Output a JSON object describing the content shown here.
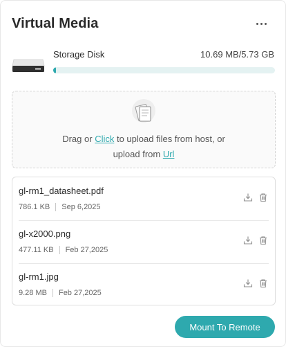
{
  "title": "Virtual Media",
  "storage": {
    "label": "Storage Disk",
    "used": "10.69 MB/5.73 GB",
    "used_fraction": 0.0018,
    "accent": "#2ea9ae",
    "track": "#e4f2f2"
  },
  "upload": {
    "pre": "Drag or ",
    "click": "Click",
    "mid": " to upload files from host, or",
    "line2_pre": "upload from ",
    "url": "Url"
  },
  "files": [
    {
      "name": "gl-rm1_datasheet.pdf",
      "size": "786.1 KB",
      "date": "Sep 6,2025"
    },
    {
      "name": "gl-x2000.png",
      "size": "477.11 KB",
      "date": "Feb 27,2025"
    },
    {
      "name": "gl-rm1.jpg",
      "size": "9.28 MB",
      "date": "Feb 27,2025"
    }
  ],
  "icons": {
    "more": "more-dots-icon",
    "disk": "hard-disk-icon",
    "upload": "documents-icon",
    "download": "download-icon",
    "delete": "trash-icon"
  },
  "actions": {
    "mount": "Mount To Remote"
  }
}
